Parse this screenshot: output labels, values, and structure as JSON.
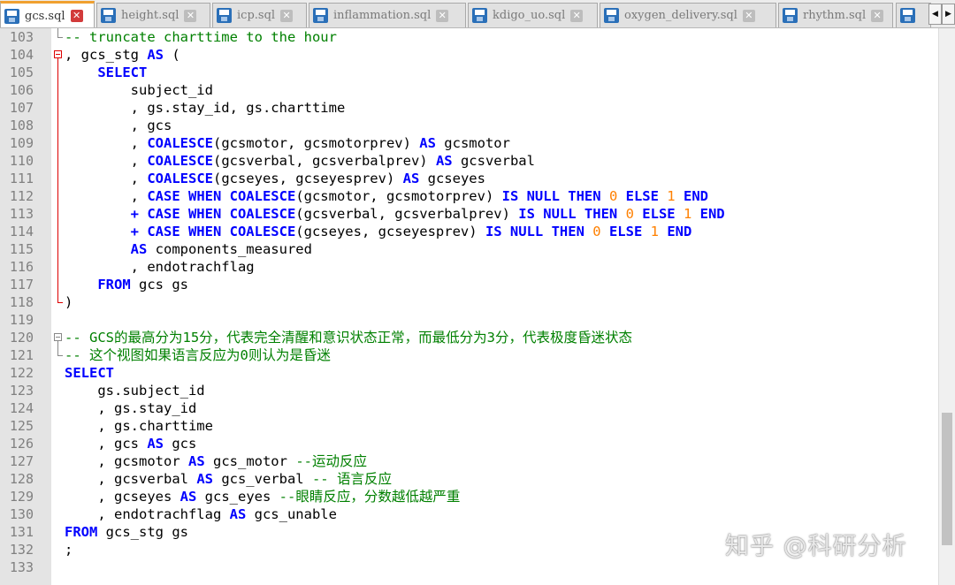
{
  "tabs": [
    {
      "label": "gcs.sql",
      "active": true
    },
    {
      "label": "height.sql",
      "active": false
    },
    {
      "label": "icp.sql",
      "active": false
    },
    {
      "label": "inflammation.sql",
      "active": false
    },
    {
      "label": "kdigo_uo.sql",
      "active": false
    },
    {
      "label": "oxygen_delivery.sql",
      "active": false
    },
    {
      "label": "rhythm.sql",
      "active": false
    }
  ],
  "tab_icon": "floppy-disk-icon",
  "colors": {
    "keyword": "#0000ff",
    "number": "#ff8000",
    "comment": "#008000",
    "highlight": "#e8e8ff",
    "fold_marker": "#dd0000"
  },
  "highlighted_line": "113",
  "lines": [
    {
      "n": "103",
      "indent": "",
      "t": [
        [
          "cm",
          "-- truncate charttime to the hour"
        ]
      ]
    },
    {
      "n": "104",
      "indent": "",
      "t": [
        [
          "",
          "., gcs_stg "
        ],
        [
          "kw",
          "AS"
        ],
        [
          "",
          " ("
        ]
      ]
    },
    {
      "n": "105",
      "indent": "    ",
      "t": [
        [
          "kw",
          "SELECT"
        ]
      ]
    },
    {
      "n": "106",
      "indent": "        ",
      "t": [
        [
          "",
          "subject_id"
        ]
      ]
    },
    {
      "n": "107",
      "indent": "        ",
      "t": [
        [
          "",
          ", gs.stay_id, gs.charttime"
        ]
      ]
    },
    {
      "n": "108",
      "indent": "        ",
      "t": [
        [
          "",
          ", gcs"
        ]
      ]
    },
    {
      "n": "109",
      "indent": "        ",
      "t": [
        [
          "",
          ", "
        ],
        [
          "kw",
          "COALESCE"
        ],
        [
          "",
          "(gcsmotor, gcsmotorprev) "
        ],
        [
          "kw",
          "AS"
        ],
        [
          "",
          " gcsmotor"
        ]
      ]
    },
    {
      "n": "110",
      "indent": "        ",
      "t": [
        [
          "",
          ", "
        ],
        [
          "kw",
          "COALESCE"
        ],
        [
          "",
          "(gcsverbal, gcsverbalprev) "
        ],
        [
          "kw",
          "AS"
        ],
        [
          "",
          " gcsverbal"
        ]
      ]
    },
    {
      "n": "111",
      "indent": "        ",
      "t": [
        [
          "",
          ", "
        ],
        [
          "kw",
          "COALESCE"
        ],
        [
          "",
          "(gcseyes, gcseyesprev) "
        ],
        [
          "kw",
          "AS"
        ],
        [
          "",
          " gcseyes"
        ]
      ]
    },
    {
      "n": "112",
      "indent": "        ",
      "t": [
        [
          "",
          ", "
        ],
        [
          "kw",
          "CASE WHEN COALESCE"
        ],
        [
          "",
          "(gcsmotor, gcsmotorprev) "
        ],
        [
          "kw",
          "IS NULL THEN"
        ],
        [
          "",
          " "
        ],
        [
          "num",
          "0"
        ],
        [
          "",
          " "
        ],
        [
          "kw",
          "ELSE"
        ],
        [
          "",
          " "
        ],
        [
          "num",
          "1"
        ],
        [
          "",
          " "
        ],
        [
          "kw",
          "END"
        ]
      ]
    },
    {
      "n": "113",
      "indent": "        ",
      "t": [
        [
          "kw",
          "+ CASE WHEN COALESCE"
        ],
        [
          "",
          "(gcsverbal, gcsverbalprev) "
        ],
        [
          "kw",
          "IS NULL THEN"
        ],
        [
          "",
          " "
        ],
        [
          "num",
          "0"
        ],
        [
          "",
          " "
        ],
        [
          "kw",
          "ELSE"
        ],
        [
          "",
          " "
        ],
        [
          "num",
          "1"
        ],
        [
          "",
          " "
        ],
        [
          "kw",
          "END"
        ]
      ]
    },
    {
      "n": "114",
      "indent": "        ",
      "t": [
        [
          "kw",
          "+ CASE WHEN COALESCE"
        ],
        [
          "",
          "(gcseyes, gcseyesprev) "
        ],
        [
          "kw",
          "IS NULL THEN"
        ],
        [
          "",
          " "
        ],
        [
          "num",
          "0"
        ],
        [
          "",
          " "
        ],
        [
          "kw",
          "ELSE"
        ],
        [
          "",
          " "
        ],
        [
          "num",
          "1"
        ],
        [
          "",
          " "
        ],
        [
          "kw",
          "END"
        ]
      ]
    },
    {
      "n": "115",
      "indent": "        ",
      "t": [
        [
          "kw",
          "AS"
        ],
        [
          "",
          " components_measured"
        ]
      ]
    },
    {
      "n": "116",
      "indent": "        ",
      "t": [
        [
          "",
          ", endotrachflag"
        ]
      ]
    },
    {
      "n": "117",
      "indent": "    ",
      "t": [
        [
          "kw",
          "FROM"
        ],
        [
          "",
          " gcs gs"
        ]
      ]
    },
    {
      "n": "118",
      "indent": "",
      "t": [
        [
          "",
          ")"
        ]
      ]
    },
    {
      "n": "119",
      "indent": "",
      "t": [
        [
          "",
          ""
        ]
      ]
    },
    {
      "n": "120",
      "indent": "",
      "t": [
        [
          "cm",
          "-- GCS的最高分为15分，代表完全清醒和意识状态正常，而最低分为3分，代表极度昏迷状态"
        ]
      ]
    },
    {
      "n": "121",
      "indent": "",
      "t": [
        [
          "cm",
          "-- 这个视图如果语言反应为0则认为是昏迷"
        ]
      ]
    },
    {
      "n": "122",
      "indent": "",
      "t": [
        [
          "kw",
          "SELECT"
        ]
      ]
    },
    {
      "n": "123",
      "indent": "    ",
      "t": [
        [
          "",
          "gs.subject_id"
        ]
      ]
    },
    {
      "n": "124",
      "indent": "    ",
      "t": [
        [
          "",
          ", gs.stay_id"
        ]
      ]
    },
    {
      "n": "125",
      "indent": "    ",
      "t": [
        [
          "",
          ", gs.charttime"
        ]
      ]
    },
    {
      "n": "126",
      "indent": "    ",
      "t": [
        [
          "",
          ", gcs "
        ],
        [
          "kw",
          "AS"
        ],
        [
          "",
          " gcs"
        ]
      ]
    },
    {
      "n": "127",
      "indent": "    ",
      "t": [
        [
          "",
          ", gcsmotor "
        ],
        [
          "kw",
          "AS"
        ],
        [
          "",
          " gcs_motor "
        ],
        [
          "cm",
          "--运动反应"
        ]
      ]
    },
    {
      "n": "128",
      "indent": "    ",
      "t": [
        [
          "",
          ", gcsverbal "
        ],
        [
          "kw",
          "AS"
        ],
        [
          "",
          " gcs_verbal "
        ],
        [
          "cm",
          "-- 语言反应"
        ]
      ]
    },
    {
      "n": "129",
      "indent": "    ",
      "t": [
        [
          "",
          ", gcseyes "
        ],
        [
          "kw",
          "AS"
        ],
        [
          "",
          " gcs_eyes "
        ],
        [
          "cm",
          "--眼睛反应，分数越低越严重"
        ]
      ]
    },
    {
      "n": "130",
      "indent": "    ",
      "t": [
        [
          "",
          ", endotrachflag "
        ],
        [
          "kw",
          "AS"
        ],
        [
          "",
          " gcs_unable"
        ]
      ]
    },
    {
      "n": "131",
      "indent": "",
      "t": [
        [
          "kw",
          "FROM"
        ],
        [
          "",
          " gcs_stg gs"
        ]
      ]
    },
    {
      "n": "132",
      "indent": "",
      "t": [
        [
          "",
          ";"
        ]
      ]
    },
    {
      "n": "133",
      "indent": "",
      "t": [
        [
          "",
          ""
        ]
      ]
    }
  ],
  "watermark": "知乎 @科研分析"
}
